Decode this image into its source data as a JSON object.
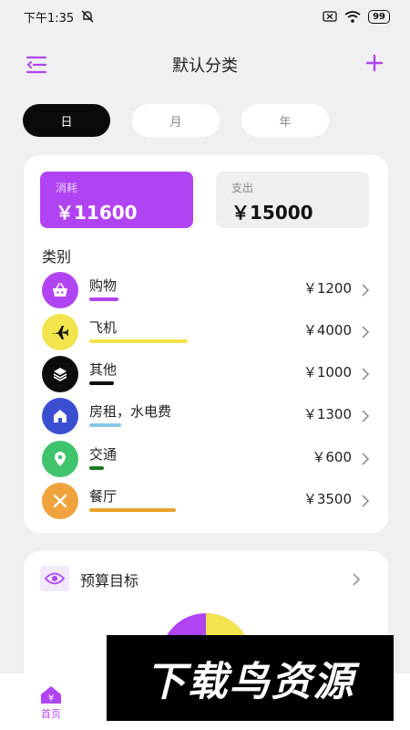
{
  "status_bar": {
    "time": "下午1:35",
    "battery": "99"
  },
  "header": {
    "title": "默认分类"
  },
  "segments": [
    {
      "label": "日",
      "active": true
    },
    {
      "label": "月",
      "active": false
    },
    {
      "label": "年",
      "active": false
    }
  ],
  "summary": {
    "consume": {
      "label": "消耗",
      "amount": "￥11600"
    },
    "spend": {
      "label": "支出",
      "amount": "￥15000"
    }
  },
  "categories_heading": "类别",
  "categories": [
    {
      "name": "购物",
      "amount": "￥1200",
      "icon": "shopping-basket-icon",
      "color": "#b144f2",
      "bar_ratio": 0.12
    },
    {
      "name": "飞机",
      "amount": "￥4000",
      "icon": "airplane-icon",
      "color": "#f1e44c",
      "bar_ratio": 0.4
    },
    {
      "name": "其他",
      "amount": "￥1000",
      "icon": "layers-icon",
      "color": "#0d0d0d",
      "bar_ratio": 0.1
    },
    {
      "name": "房租，水电费",
      "amount": "￥1300",
      "icon": "house-icon",
      "color": "#3a4fcf",
      "bar_ratio": 0.13
    },
    {
      "name": "交通",
      "amount": "￥600",
      "icon": "location-pin-icon",
      "color": "#3fc46b",
      "bar_ratio": 0.06
    },
    {
      "name": "餐厅",
      "amount": "￥3500",
      "icon": "utensils-icon",
      "color": "#f0a23c",
      "bar_ratio": 0.35
    }
  ],
  "category_bar_colors": [
    "#b144f2",
    "#f1e44c",
    "#0d0d0d",
    "#86c8e6",
    "#1a7a22",
    "#e8a52a"
  ],
  "budget": {
    "title": "预算目标"
  },
  "tabbar": {
    "home_label": "首页",
    "home_icon": "yen-house-icon"
  },
  "watermark": {
    "text": "下载鸟资源"
  },
  "colors": {
    "accent": "#b144f2",
    "background": "#f0eff1"
  }
}
